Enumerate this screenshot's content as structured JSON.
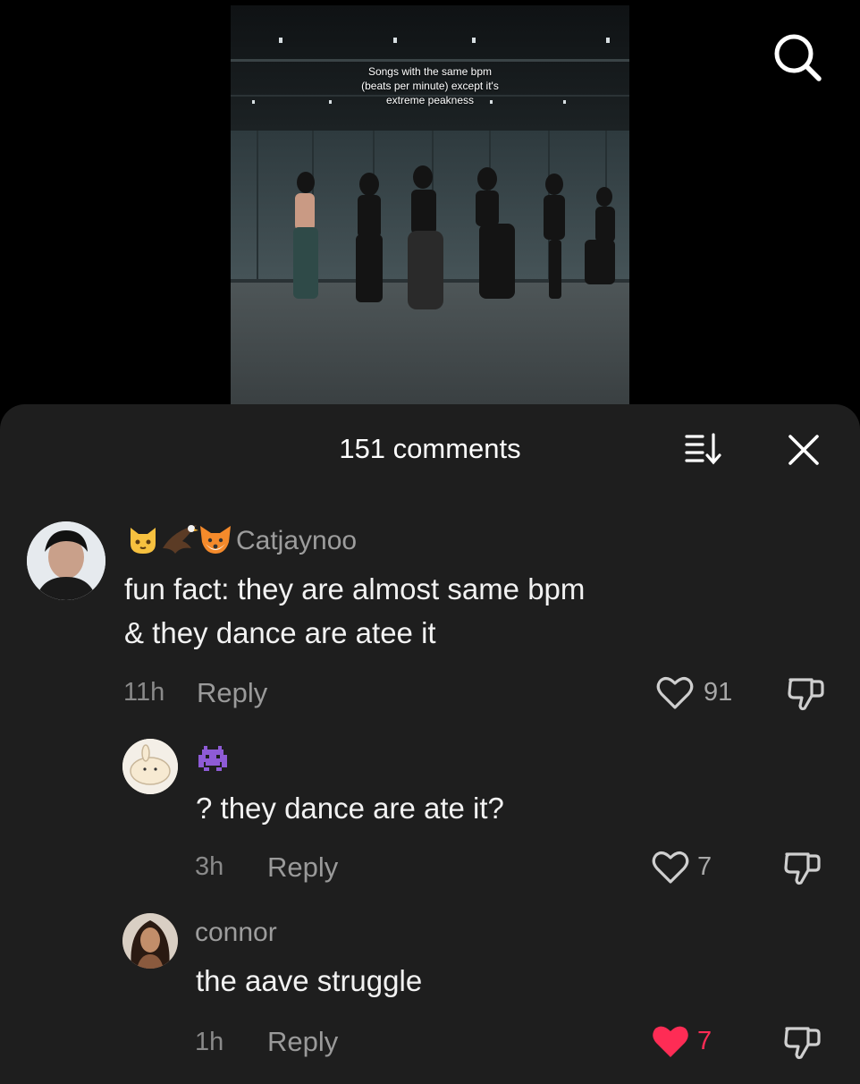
{
  "video": {
    "caption_lines": [
      "Songs with the same bpm",
      "(beats per minute) except it's",
      "extreme peakness"
    ]
  },
  "header": {
    "icon": "search-icon"
  },
  "comments_sheet": {
    "title": "151 comments",
    "sort_icon": "sort-icon",
    "close_icon": "close-icon",
    "comments": [
      {
        "username": "Catjaynoo",
        "username_emojis": [
          "cat-face",
          "eagle",
          "fox-face"
        ],
        "text_lines": [
          "fun fact: they are almost same bpm",
          "& they dance are atee it"
        ],
        "time": "11h",
        "reply_label": "Reply",
        "likes": "91",
        "liked": false
      },
      {
        "username": "",
        "username_emojis": [
          "alien-monster"
        ],
        "text_lines": [
          "? they dance are ate it?"
        ],
        "time": "3h",
        "reply_label": "Reply",
        "likes": "7",
        "liked": false
      },
      {
        "username": "connor",
        "username_emojis": [],
        "text_lines": [
          "the aave struggle"
        ],
        "time": "1h",
        "reply_label": "Reply",
        "likes": "7",
        "liked": true
      }
    ]
  },
  "colors": {
    "sheet_bg": "#1e1e1e",
    "liked_heart": "#fe2c55",
    "muted_text": "#9a9a9a"
  }
}
